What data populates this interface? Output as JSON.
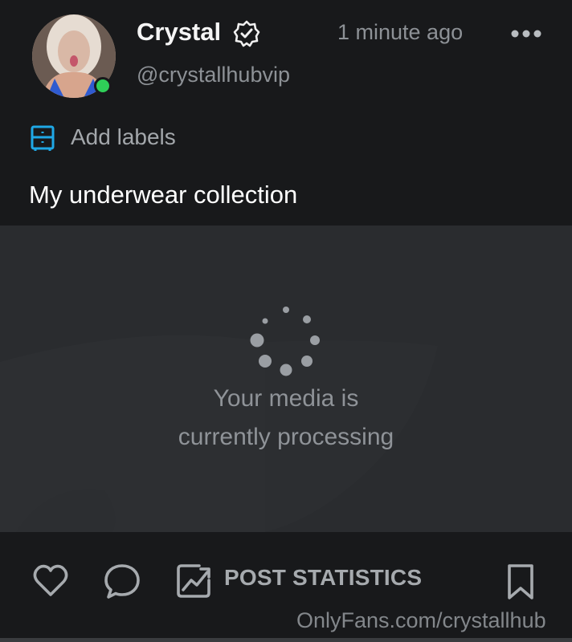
{
  "post": {
    "author_name": "Crystal",
    "author_handle": "@crystallhubvip",
    "timestamp": "1 minute ago",
    "add_labels": "Add labels",
    "text": "My underwear collection"
  },
  "media": {
    "processing_line1": "Your media is",
    "processing_line2": "currently processing"
  },
  "actions": {
    "post_statistics": "POST STATISTICS"
  },
  "watermark": "OnlyFans.com/crystallhub",
  "icons": {
    "verified": "verified-badge-icon",
    "more": "more-dots-icon",
    "labels": "labels-icon",
    "like": "heart-icon",
    "comment": "comment-icon",
    "stats": "chart-icon",
    "bookmark": "bookmark-icon"
  },
  "colors": {
    "background": "#18191b",
    "media_background": "#2a2c2f",
    "accent_blue": "#1fa8e6",
    "online_green": "#2fcf58",
    "muted_text": "#8d9196"
  }
}
